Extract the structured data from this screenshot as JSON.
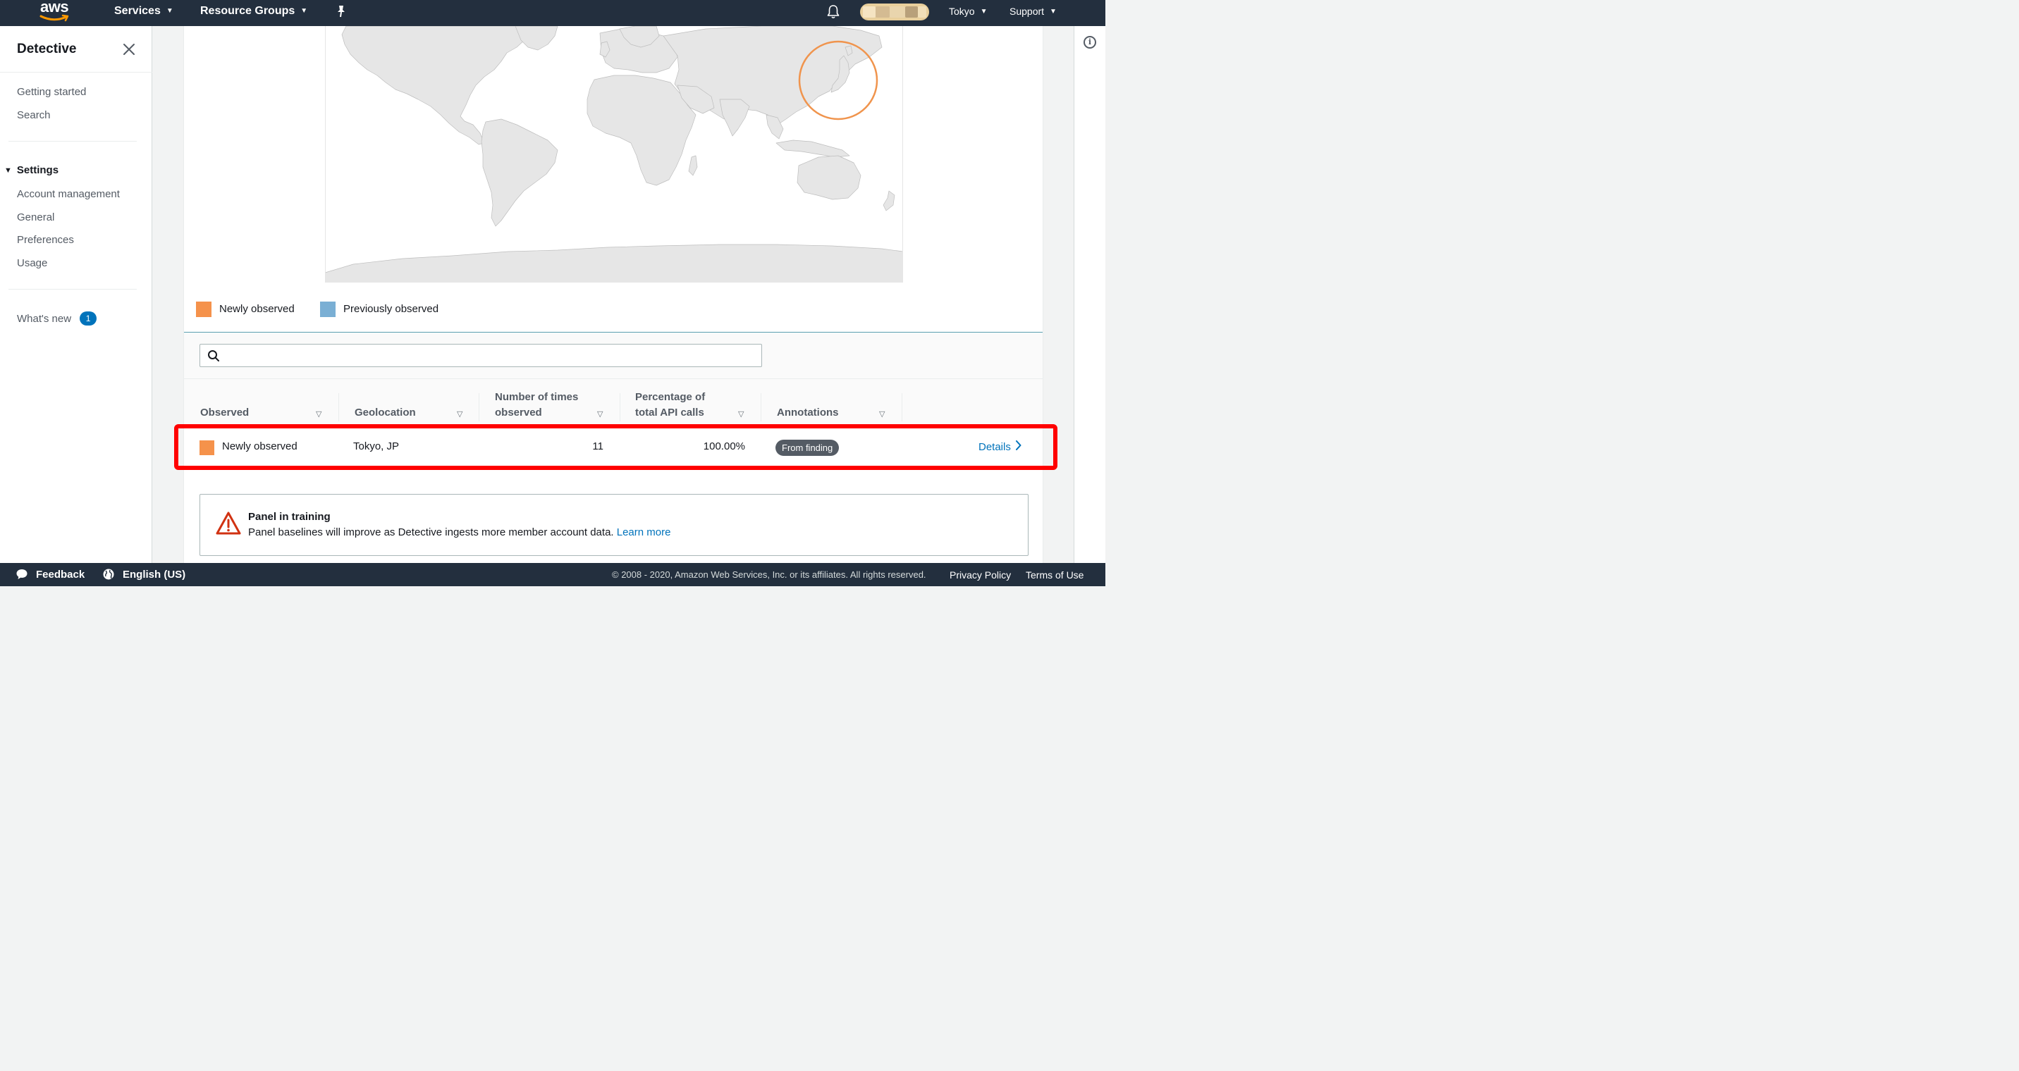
{
  "header": {
    "logo_text": "aws",
    "nav": [
      {
        "label": "Services"
      },
      {
        "label": "Resource Groups"
      }
    ],
    "region": "Tokyo",
    "support": "Support",
    "colors": {
      "bar": "#232f3e",
      "smile": "#ff9900"
    }
  },
  "sidebar": {
    "title": "Detective",
    "top_links": [
      "Getting started",
      "Search"
    ],
    "section_title": "Settings",
    "section_links": [
      "Account management",
      "General",
      "Preferences",
      "Usage"
    ],
    "whats_new": {
      "label": "What's new",
      "count": "1"
    }
  },
  "map": {
    "highlight_region": "Japan",
    "highlight_color": "#f0944d"
  },
  "legend": [
    {
      "label": "Newly observed",
      "color": "#f5924b"
    },
    {
      "label": "Previously observed",
      "color": "#7aafd4"
    }
  ],
  "search": {
    "value": "",
    "placeholder": ""
  },
  "table": {
    "columns": [
      {
        "line1": "Observed",
        "line2": ""
      },
      {
        "line1": "Geolocation",
        "line2": ""
      },
      {
        "line1": "Number of times",
        "line2": "observed"
      },
      {
        "line1": "Percentage of",
        "line2": "total API calls"
      },
      {
        "line1": "Annotations",
        "line2": ""
      }
    ],
    "rows": [
      {
        "observed": "Newly observed",
        "geolocation": "Tokyo, JP",
        "count": "11",
        "percentage": "100.00%",
        "annotation": "From finding",
        "link": "Details"
      }
    ]
  },
  "alert": {
    "title": "Panel in training",
    "body": "Panel baselines will improve as Detective ingests more member account data.",
    "link": "Learn more"
  },
  "footer": {
    "feedback": "Feedback",
    "language": "English (US)",
    "copyright": "© 2008 - 2020, Amazon Web Services, Inc. or its affiliates. All rights reserved.",
    "privacy": "Privacy Policy",
    "terms": "Terms of Use"
  }
}
